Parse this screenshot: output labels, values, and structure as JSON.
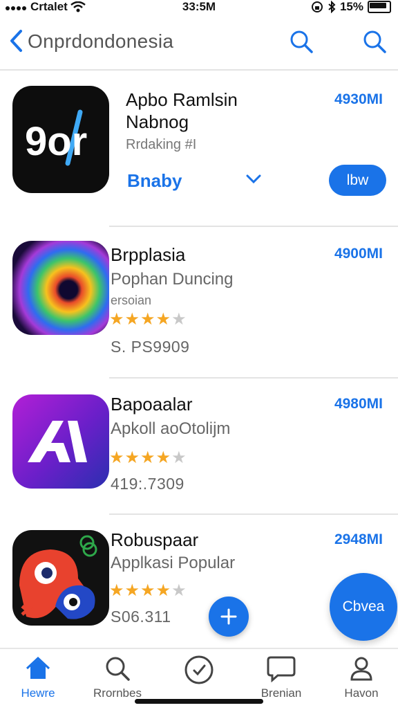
{
  "status": {
    "carrier": "Crtalet",
    "time": "33:5M",
    "battery": "15%"
  },
  "nav": {
    "title": "Onprdondonesia"
  },
  "featured": {
    "icon_text": "9or",
    "name_line1": "Apbo Ramlsin",
    "name_line2": "Nabnog",
    "subtitle": "Rrdaking #I",
    "link": "Bnaby",
    "size": "4930MI",
    "get_label": "lbw"
  },
  "apps": [
    {
      "name": "Brpplasia",
      "sub": "Pophan Duncing",
      "small": "ersoian",
      "size": "4900MI",
      "rating": 4,
      "price": "S. PS9909"
    },
    {
      "name": "Bapoaalar",
      "sub": "Apkoll aoOtolijm",
      "size": "4980MI",
      "rating": 4,
      "price": "419:.7309"
    },
    {
      "name": "Robuspaar",
      "sub": "Applkasi Popular",
      "size": "2948MI",
      "rating": 4,
      "price": "S06.311"
    }
  ],
  "fab_label": "Cbvea",
  "tabs": [
    {
      "label": "Hewre",
      "icon": "home-icon",
      "active": true
    },
    {
      "label": "Rrornbes",
      "icon": "search-icon",
      "active": false
    },
    {
      "label": "",
      "icon": "check-circle-icon",
      "active": false
    },
    {
      "label": "Brenian",
      "icon": "chat-bubble-icon",
      "active": false
    },
    {
      "label": "Havon",
      "icon": "profile-icon",
      "active": false
    }
  ],
  "colors": {
    "accent": "#1a73e8",
    "star": "#f5a623",
    "star_empty": "#c8c8c8"
  }
}
